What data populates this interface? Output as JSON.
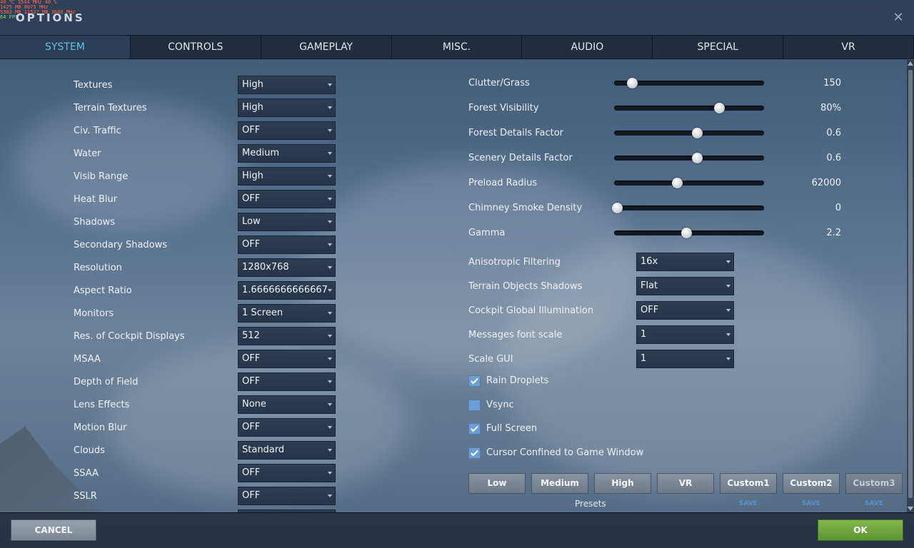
{
  "hud": {
    "row1": "   40 ℃      1544 MHz     40 %",
    "row2": " 1425 MB     6075 MHz",
    "row3": " 5302 MB    11527 MB    3600 MHz",
    "fps": "  64 FPS"
  },
  "window": {
    "title": "OPTIONS",
    "close_icon": "close-icon"
  },
  "tabs": [
    "SYSTEM",
    "CONTROLS",
    "GAMEPLAY",
    "MISC.",
    "AUDIO",
    "SPECIAL",
    "VR"
  ],
  "active_tab": "SYSTEM",
  "left_settings": [
    {
      "label": "Textures",
      "value": "High"
    },
    {
      "label": "Terrain Textures",
      "value": "High"
    },
    {
      "label": "Civ. Traffic",
      "value": "OFF"
    },
    {
      "label": "Water",
      "value": "Medium"
    },
    {
      "label": "Visib Range",
      "value": "High"
    },
    {
      "label": "Heat Blur",
      "value": "OFF"
    },
    {
      "label": "Shadows",
      "value": "Low"
    },
    {
      "label": "Secondary Shadows",
      "value": "OFF"
    },
    {
      "label": "Resolution",
      "value": "1280x768"
    },
    {
      "label": "Aspect Ratio",
      "value": "1.6666666666667"
    },
    {
      "label": "Monitors",
      "value": "1 Screen"
    },
    {
      "label": "Res. of Cockpit Displays",
      "value": "512"
    },
    {
      "label": "MSAA",
      "value": "OFF"
    },
    {
      "label": "Depth of Field",
      "value": "OFF"
    },
    {
      "label": "Lens Effects",
      "value": "None"
    },
    {
      "label": "Motion Blur",
      "value": "OFF"
    },
    {
      "label": "Clouds",
      "value": "Standard"
    },
    {
      "label": "SSAA",
      "value": "OFF"
    },
    {
      "label": "SSLR",
      "value": "OFF"
    }
  ],
  "sliders": [
    {
      "label": "Clutter/Grass",
      "value": "150",
      "fraction": 0.12
    },
    {
      "label": "Forest Visibility",
      "value": "80%",
      "fraction": 0.7
    },
    {
      "label": "Forest Details Factor",
      "value": "0.6",
      "fraction": 0.55
    },
    {
      "label": "Scenery Details Factor",
      "value": "0.6",
      "fraction": 0.55
    },
    {
      "label": "Preload Radius",
      "value": "62000",
      "fraction": 0.42
    },
    {
      "label": "Chimney Smoke Density",
      "value": "0",
      "fraction": 0.02
    },
    {
      "label": "Gamma",
      "value": "2.2",
      "fraction": 0.48
    }
  ],
  "right_settings": [
    {
      "label": "Anisotropic Filtering",
      "value": "16x"
    },
    {
      "label": "Terrain Objects Shadows",
      "value": "Flat"
    },
    {
      "label": "Cockpit Global Illumination",
      "value": "OFF"
    },
    {
      "label": "Messages font scale",
      "value": "1"
    },
    {
      "label": "Scale GUI",
      "value": "1"
    }
  ],
  "checkboxes": [
    {
      "label": "Rain Droplets",
      "checked": true
    },
    {
      "label": "Vsync",
      "checked": false
    },
    {
      "label": "Full Screen",
      "checked": true
    },
    {
      "label": "Cursor Confined to Game Window",
      "checked": true
    }
  ],
  "presets": {
    "label": "Presets",
    "buttons": [
      "Low",
      "Medium",
      "High",
      "VR",
      "Custom1",
      "Custom2",
      "Custom3"
    ],
    "save_label": "SAVE"
  },
  "footer": {
    "cancel": "CANCEL",
    "ok": "OK"
  },
  "colors": {
    "accent_tab": "#5ec4e8",
    "ok_green": "#6aa63c",
    "checkbox_blue": "#6d9fd7",
    "save_link": "#5b8fcf"
  }
}
